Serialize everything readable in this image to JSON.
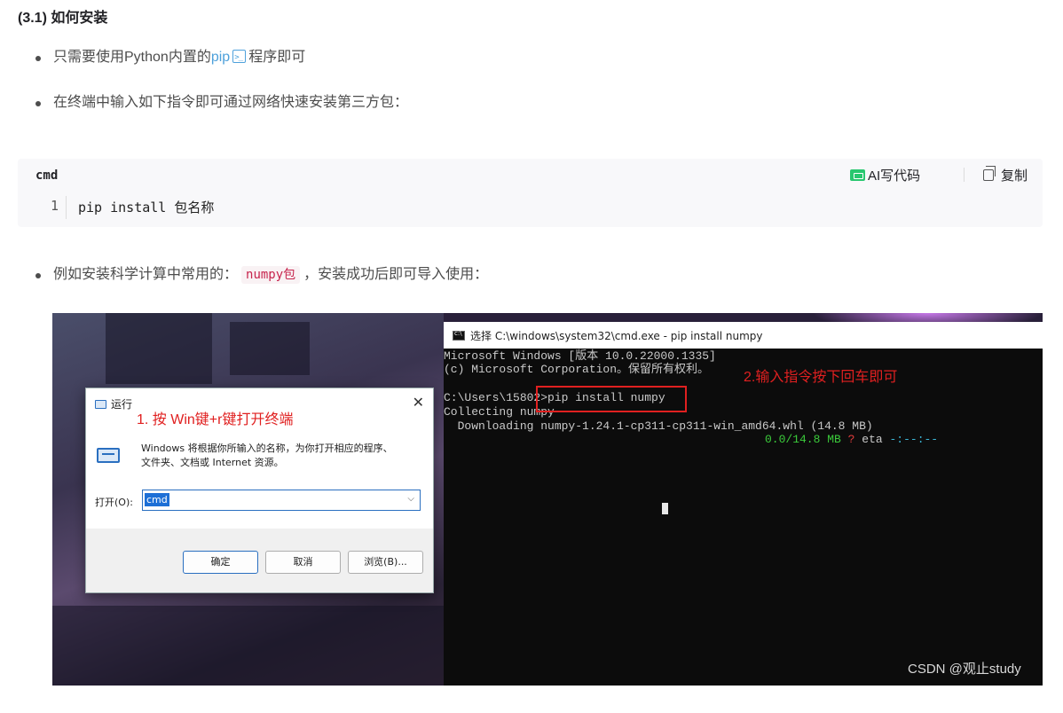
{
  "heading": "(3.1) 如何安装",
  "bullets": {
    "b1_before": "只需要使用Python内置的",
    "b1_link": "pip",
    "b1_after": "程序即可",
    "b2": "在终端中输入如下指令即可通过网络快速安装第三方包：",
    "b3_before": "例如安装科学计算中常用的：",
    "b3_code": "numpy包",
    "b3_after": "，安装成功后即可导入使用："
  },
  "codeblock": {
    "lang": "cmd",
    "ai_label": "AI写代码",
    "copy_label": "复制",
    "line_number": "1",
    "code": "pip install 包名称"
  },
  "run_dialog": {
    "title": "运行",
    "annotation": "1. 按 Win键+r键打开终端",
    "desc_line1": "Windows 将根据你所输入的名称，为你打开相应的程序、",
    "desc_line2": "文件夹、文档或 Internet 资源。",
    "open_label": "打开(O):",
    "input_value": "cmd",
    "ok_label": "确定",
    "cancel_label": "取消",
    "browse_label": "浏览(B)..."
  },
  "cmd_window": {
    "title": "选择 C:\\windows\\system32\\cmd.exe - pip  install numpy",
    "line1": "Microsoft Windows [版本 10.0.22000.1335]",
    "line2": "(c) Microsoft Corporation。保留所有权利。",
    "line3": "C:\\Users\\15802>pip install numpy",
    "line4": "Collecting numpy",
    "line5": "  Downloading numpy-1.24.1-cp311-cp311-win_amd64.whl (14.8 MB)",
    "progress": "0.0/14.8 MB",
    "progress_q": "?",
    "eta_label": "eta",
    "eta_value": "-:--:--",
    "annotation": "2.输入指令按下回车即可"
  },
  "watermark": "CSDN @观止study",
  "colors": {
    "link": "#4ea1db",
    "annotation_red": "#e02020",
    "terminal_green": "#3bcc3b"
  }
}
